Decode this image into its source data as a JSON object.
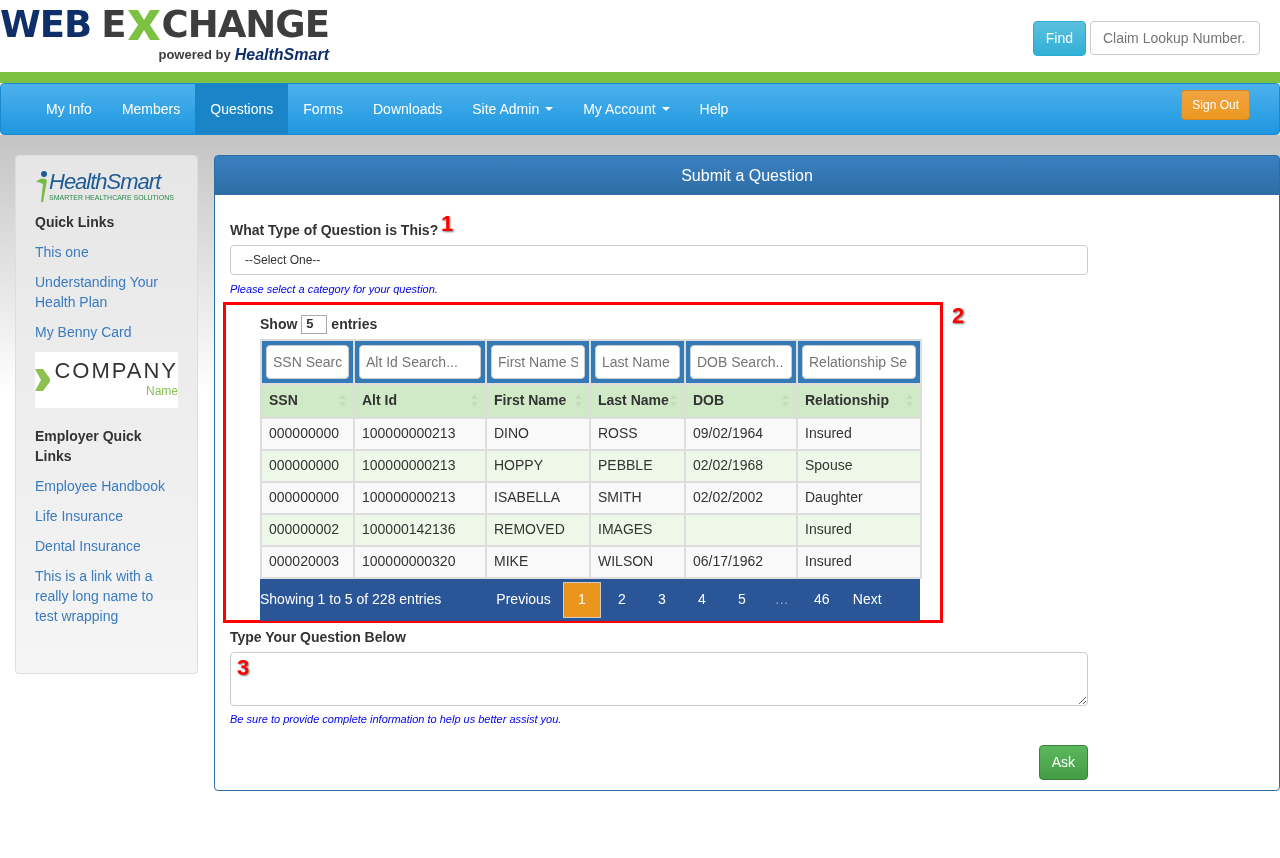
{
  "header": {
    "logo": {
      "word_start": "WEB",
      "letter_before_x": "E",
      "word_end": "CHANGE",
      "tagline": "powered by",
      "brand": "HealthSmart"
    },
    "find_button": "Find",
    "claim_search": {
      "placeholder": "Claim Lookup Number.."
    }
  },
  "nav": {
    "items": [
      {
        "label": "My Info",
        "selected": false,
        "dropdown": false
      },
      {
        "label": "Members",
        "selected": false,
        "dropdown": false
      },
      {
        "label": "Questions",
        "selected": true,
        "dropdown": false
      },
      {
        "label": "Forms",
        "selected": false,
        "dropdown": false
      },
      {
        "label": "Downloads",
        "selected": false,
        "dropdown": false
      },
      {
        "label": "Site Admin",
        "selected": false,
        "dropdown": true
      },
      {
        "label": "My Account",
        "selected": false,
        "dropdown": true
      },
      {
        "label": "Help",
        "selected": false,
        "dropdown": false
      }
    ],
    "sign_out": "Sign Out"
  },
  "sidebar": {
    "brand_logo": {
      "name": "HealthSmart",
      "tagline": "SMARTER HEALTHCARE SOLUTIONS"
    },
    "quick_links_title": "Quick Links",
    "quick_links": [
      "This one",
      "Understanding Your Health Plan",
      "My Benny Card"
    ],
    "company_logo": {
      "name": "COMPANY",
      "sub": "Name"
    },
    "employer_links_title": "Employer Quick Links",
    "employer_links": [
      "Employee Handbook",
      "Life Insurance",
      "Dental Insurance",
      "This is a link with a really long name to test wrapping"
    ]
  },
  "panel": {
    "title": "Submit a Question",
    "question_type": {
      "label": "What Type of Question is This?",
      "value": "--Select One--",
      "help": "Please select a category for your question."
    },
    "table": {
      "length": {
        "prefix": "Show",
        "value": "5",
        "suffix": "entries"
      },
      "columns": [
        {
          "title": "SSN",
          "filter_placeholder": "SSN Searc"
        },
        {
          "title": "Alt Id",
          "filter_placeholder": "Alt Id Search..."
        },
        {
          "title": "First Name",
          "filter_placeholder": "First Name S"
        },
        {
          "title": "Last Name",
          "filter_placeholder": "Last Name"
        },
        {
          "title": "DOB",
          "filter_placeholder": "DOB Search.."
        },
        {
          "title": "Relationship",
          "filter_placeholder": "Relationship Se"
        }
      ],
      "rows": [
        [
          "000000000",
          "100000000213",
          "DINO",
          "ROSS",
          "09/02/1964",
          "Insured"
        ],
        [
          "000000000",
          "100000000213",
          "HOPPY",
          "PEBBLE",
          "02/02/1968",
          "Spouse"
        ],
        [
          "000000000",
          "100000000213",
          "ISABELLA",
          "SMITH",
          "02/02/2002",
          "Daughter"
        ],
        [
          "000000002",
          "100000142136",
          "REMOVED",
          "IMAGES",
          null,
          "Insured"
        ],
        [
          "000020003",
          "100000000320",
          "MIKE",
          "WILSON",
          "06/17/1962",
          "Insured"
        ]
      ],
      "info": "Showing 1 to 5 of 228 entries",
      "pages": [
        {
          "label": "Previous",
          "selected": false,
          "disabled": false
        },
        {
          "label": "1",
          "selected": true,
          "disabled": false
        },
        {
          "label": "2",
          "selected": false,
          "disabled": false
        },
        {
          "label": "3",
          "selected": false,
          "disabled": false
        },
        {
          "label": "4",
          "selected": false,
          "disabled": false
        },
        {
          "label": "5",
          "selected": false,
          "disabled": false
        },
        {
          "label": "…",
          "selected": false,
          "disabled": true
        },
        {
          "label": "46",
          "selected": false,
          "disabled": false
        },
        {
          "label": "Next",
          "selected": false,
          "disabled": false
        }
      ]
    },
    "question": {
      "label": "Type Your Question Below",
      "help": "Be sure to provide complete information to help us better assist you."
    },
    "ask_button": "Ask"
  },
  "annotations": [
    "1",
    "2",
    "3"
  ]
}
